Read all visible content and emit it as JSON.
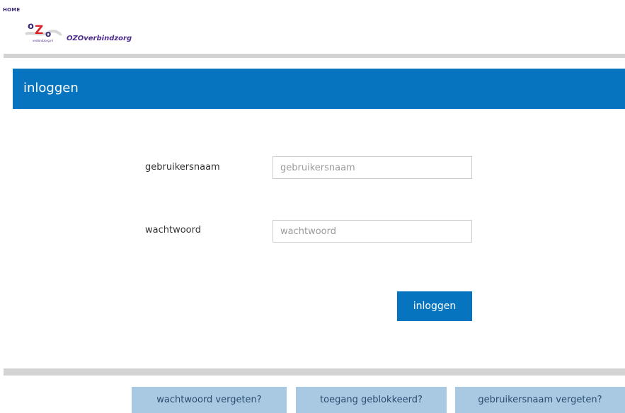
{
  "header": {
    "home_label": "HOME",
    "brand_name": "OZOverbindzorg",
    "logo": {
      "letters": [
        "o",
        "Z",
        "o"
      ],
      "small_text": "verbindzorg.nl"
    }
  },
  "colors": {
    "accent": "#0774c0",
    "secondary_button": "#a9c9e3",
    "divider": "#d3d3d3",
    "brand_purple": "#4b2b8c"
  },
  "login": {
    "title": "inloggen",
    "username": {
      "label": "gebruikersnaam",
      "placeholder": "gebruikersnaam",
      "value": ""
    },
    "password": {
      "label": "wachtwoord",
      "placeholder": "wachtwoord",
      "value": ""
    },
    "submit_label": "inloggen"
  },
  "footer": {
    "forgot_password": "wachtwoord vergeten?",
    "access_blocked": "toegang geblokkeerd?",
    "forgot_username": "gebruikersnaam vergeten?"
  }
}
